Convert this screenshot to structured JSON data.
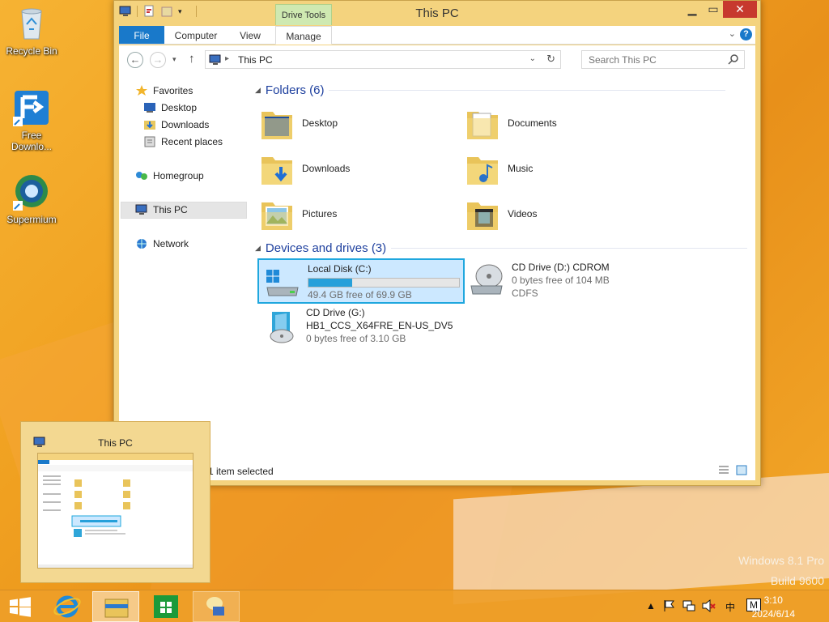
{
  "desktop": {
    "icons": [
      {
        "label": "Recycle Bin"
      },
      {
        "label": "Free\nDownlo..."
      },
      {
        "label": "Supermium"
      }
    ],
    "watermark": {
      "line1": "Windows 8.1 Pro",
      "line2": "Build 9600"
    }
  },
  "window": {
    "title": "This PC",
    "context_tab": "Drive Tools",
    "ribbon_tabs": [
      "File",
      "Computer",
      "View",
      "Manage"
    ],
    "address": "This PC",
    "search_placeholder": "Search This PC",
    "nav": {
      "favorites": "Favorites",
      "desktop": "Desktop",
      "downloads": "Downloads",
      "recent": "Recent places",
      "homegroup": "Homegroup",
      "thispc": "This PC",
      "network": "Network"
    },
    "folders_header": "Folders (6)",
    "folders": [
      "Desktop",
      "Documents",
      "Downloads",
      "Music",
      "Pictures",
      "Videos"
    ],
    "drives_header": "Devices and drives (3)",
    "drives": [
      {
        "name": "Local Disk (C:)",
        "free": "49.4 GB free of 69.9 GB",
        "used_fraction": 0.29
      },
      {
        "name": "CD Drive (D:) CDROM",
        "free": "0 bytes free of 104 MB",
        "fs": "CDFS"
      },
      {
        "name": "CD Drive (G:)",
        "label": "HB1_CCS_X64FRE_EN-US_DV5",
        "free": "0 bytes free of 3.10 GB"
      }
    ],
    "status": "1 item selected"
  },
  "thumbnail": {
    "title": "This PC"
  },
  "taskbar": {
    "time": "3:10",
    "date": "2024/6/14",
    "ime": "中",
    "ime2": "M"
  },
  "colors": {
    "accent": "#1979ca",
    "selection": "#cce8ff",
    "wallpaper": "#f0a020"
  }
}
